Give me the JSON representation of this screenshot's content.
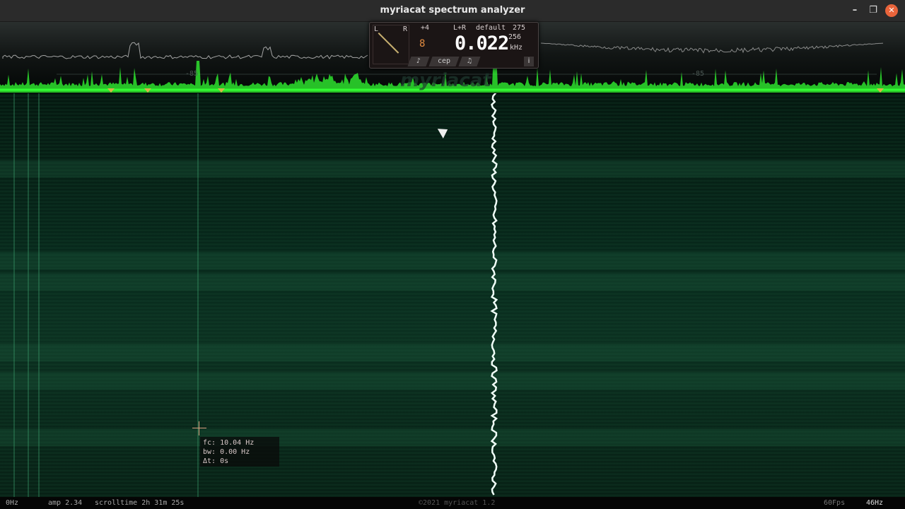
{
  "window": {
    "title": "myriacat spectrum analyzer",
    "minimize": "–",
    "maximize": "❐",
    "close": "✕"
  },
  "spectrum": {
    "db_left": "-85",
    "db_right": "-85",
    "accent": "#33ff33"
  },
  "panel": {
    "gain": "+4",
    "channel_mode": "L+R",
    "preset": "default",
    "top_value": "275",
    "fft_size": "256",
    "channel_digits": "8",
    "frequency": "0.022",
    "unit": "kHz",
    "tabs": [
      {
        "label": "♪",
        "icon": "note-icon"
      },
      {
        "label": "cep"
      },
      {
        "label": "♫",
        "icon": "music-icon"
      }
    ],
    "info": "i",
    "meter_left": "L",
    "meter_right": "R"
  },
  "watermark": "myriacat",
  "tooltip": {
    "fc": "fc: 10.04 Hz",
    "bw": "bw: 0.00 Hz",
    "dt": "Δt: 0s"
  },
  "status": {
    "left_freq": "0Hz",
    "amp": "amp 2.34",
    "scrolltime": "scrolltime 2h 31m 25s",
    "copyright": "©2021 myriacat 1.2",
    "fps": "60Fps",
    "right_freq": "46Hz"
  }
}
